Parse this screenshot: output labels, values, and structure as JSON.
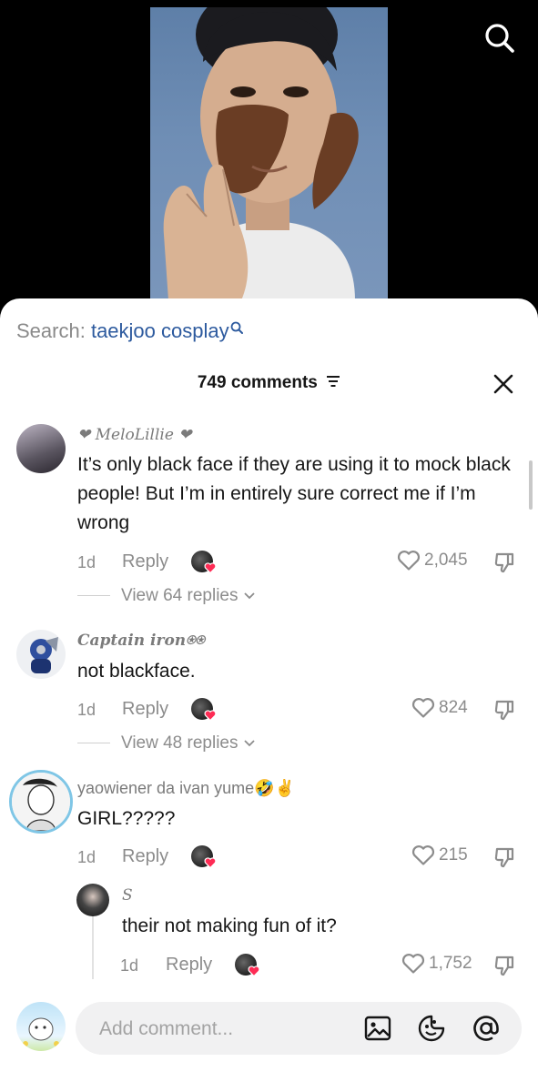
{
  "search": {
    "prefix": "Search:",
    "term": "taekjoo cosplay"
  },
  "comments_header": {
    "count_label": "749 comments"
  },
  "comments": [
    {
      "username": "❤ MeloLillie ❤",
      "text": "It’s only black face if they are using it to mock black people! But I’m in entirely sure correct me if I’m wrong",
      "time": "1d",
      "reply_label": "Reply",
      "likes": "2,045",
      "view_replies": "View 64 replies"
    },
    {
      "username": "Captain iron⍟⍟",
      "text": "not blackface.",
      "time": "1d",
      "reply_label": "Reply",
      "likes": "824",
      "view_replies": "View 48 replies"
    },
    {
      "username": "yaowiener da ivan yume🤣✌",
      "text": "GIRL?????",
      "time": "1d",
      "reply_label": "Reply",
      "likes": "215"
    }
  ],
  "reply": {
    "username": "S",
    "text": "their not making fun of it?",
    "time": "1d",
    "reply_label": "Reply",
    "likes": "1,752"
  },
  "composer": {
    "placeholder": "Add comment..."
  },
  "colors": {
    "accent": "#2d5a9e",
    "heart": "#fe2c55",
    "muted": "#8c8c8c"
  },
  "icons": [
    "search-icon",
    "filter-icon",
    "close-icon",
    "heart-icon",
    "dislike-icon",
    "chevron-down-icon",
    "image-icon",
    "emoji-icon",
    "mention-icon"
  ]
}
